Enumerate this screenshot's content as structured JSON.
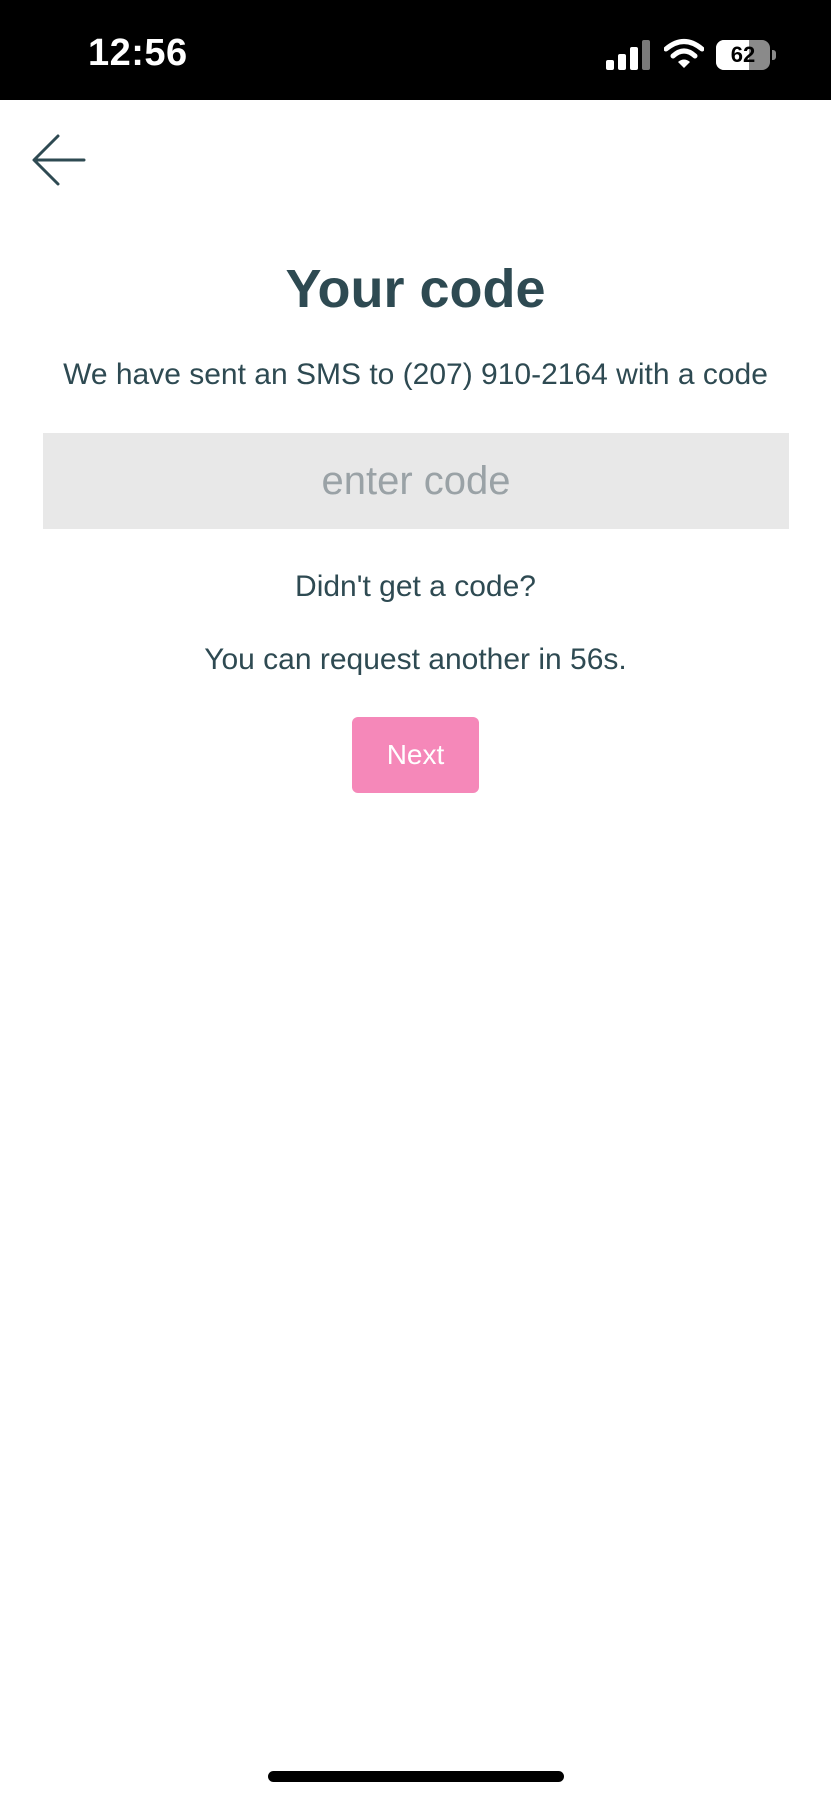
{
  "status_bar": {
    "time": "12:56",
    "battery_percent": "62",
    "battery_level": 0.62,
    "signal_icon": "cellular-signal-icon",
    "wifi_icon": "wifi-icon",
    "battery_icon": "battery-icon"
  },
  "nav": {
    "back_icon": "arrow-left-icon"
  },
  "main": {
    "title": "Your code",
    "subtitle": "We have sent an SMS to (207) 910-2164 with a code",
    "code_input": {
      "value": "",
      "placeholder": "enter code"
    },
    "resend_question": "Didn't get a code?",
    "resend_timer": "You can request another in 56s.",
    "next_label": "Next"
  },
  "colors": {
    "text": "#2e4a52",
    "accent": "#f588b9",
    "input_background": "#e8e8e8",
    "placeholder": "#9aa2a6"
  }
}
